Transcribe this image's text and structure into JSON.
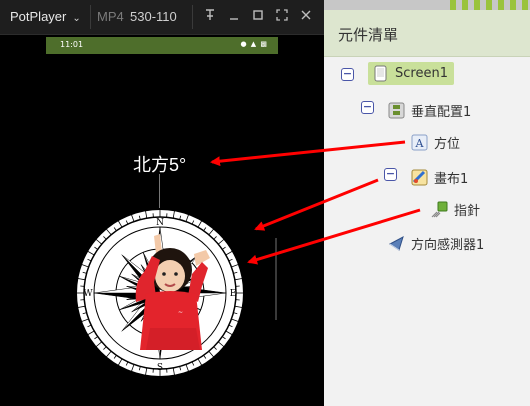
{
  "player": {
    "app_name": "PotPlayer",
    "format": "MP4",
    "file_name": "530-110",
    "window_buttons": [
      "pin-icon",
      "minimize-icon",
      "maximize-icon",
      "fullscreen-icon",
      "close-icon"
    ]
  },
  "phone": {
    "status_time": "11:01",
    "heading_text": "北方5°"
  },
  "panel": {
    "title": "元件清單",
    "tree": {
      "screen": "Screen1",
      "vertical_arrangement": "垂直配置1",
      "label": "方位",
      "canvas": "畫布1",
      "sprite": "指針",
      "orientation_sensor": "方向感測器1"
    }
  },
  "colors": {
    "arrow": "#ff0000",
    "panel_header": "#dde6cf",
    "screen_highlight": "#c9e09a",
    "phone_statusbar": "#4e6e2b"
  }
}
